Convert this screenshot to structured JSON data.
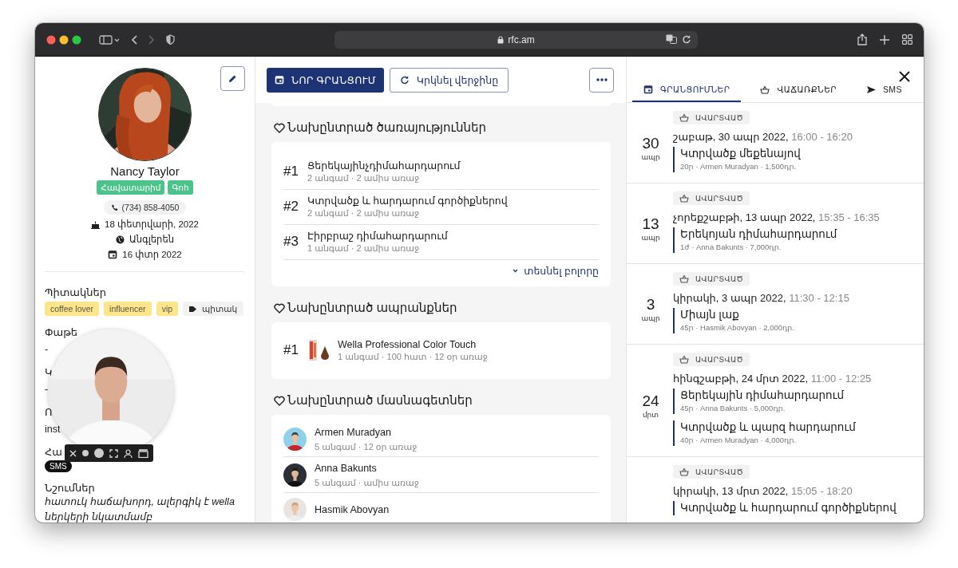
{
  "browser": {
    "url": "rfc.am"
  },
  "profile": {
    "name": "Nancy Taylor",
    "badges": [
      "Հավատարիմ",
      "Գոհ"
    ],
    "phone": "(734) 858-4050",
    "birthday": "18 փետրվարի, 2022",
    "language": "Անգլերեն",
    "since": "16 փտր 2022"
  },
  "tags": {
    "title": "Պիտակներ",
    "items": [
      {
        "label": "coffee lover",
        "kind": "tag"
      },
      {
        "label": "influencer",
        "kind": "tag"
      },
      {
        "label": "vip",
        "kind": "tag"
      },
      {
        "label": "պիտակ",
        "kind": "add"
      }
    ]
  },
  "fields": [
    {
      "label": "Փաթե",
      "value": "-"
    },
    {
      "label": "Կ",
      "value": "-"
    },
    {
      "label": "Ո",
      "value": "inst"
    },
    {
      "label": "Հա",
      "chip": "SMS"
    }
  ],
  "notes": {
    "title": "Նշումներ",
    "text": "հատուկ հաճախորդ, ալերգիկ է wella ներկերի նկատմամբ"
  },
  "toolbar": {
    "new_booking": "ՆՈՐ ԳՐԱՆՑՈՒՄ",
    "repeat": "Կրկնել վերջինը"
  },
  "services": {
    "title": "Նախընտրած ծառայություններ",
    "items": [
      {
        "rank": "#1",
        "name": "Ցերեկայինչդիմահարդարում",
        "meta": "2 անգամ · 2 ամիս առաջ"
      },
      {
        "rank": "#2",
        "name": "Կտրվածք և հարդարում գործիքներով",
        "meta": "2 անգամ · 2 ամիս առաջ"
      },
      {
        "rank": "#3",
        "name": "Էիրբրաշ դիմահարդարում",
        "meta": "1 անգամ · 2 ամիս առաջ"
      }
    ],
    "more": "տեսնել բոլորը"
  },
  "products": {
    "title": "Նախընտրած ապրանքներ",
    "items": [
      {
        "rank": "#1",
        "name": "Wella Professional Color Touch",
        "meta": "1 անգամ · 100 հատ · 12 օր առաջ"
      }
    ]
  },
  "specialists": {
    "title": "Նախընտրած մասնագետներ",
    "items": [
      {
        "name": "Armen Muradyan",
        "meta": "5 անգամ · 12 օր առաջ"
      },
      {
        "name": "Anna Bakunts",
        "meta": "5 անգամ · ամիս առաջ"
      },
      {
        "name": "Hasmik Abovyan"
      }
    ]
  },
  "tabs": [
    {
      "label": "ԳՐԱՆՑՈՒՄՆԵՐ",
      "selected": true
    },
    {
      "label": "ՎԱՃԱՌՔՆԵՐ",
      "selected": false
    },
    {
      "label": "SMS",
      "selected": false
    }
  ],
  "appointments": [
    {
      "day": "30",
      "month": "ապր",
      "status": "ԱՎԱՐՏՎԱԾ",
      "date": "շաբաթ, 30 ապր 2022,",
      "time": "16:00 - 16:20",
      "services": [
        {
          "name": "Կտրվածք մեքենայով",
          "meta": "20ր · Armen Muradyan · 1,500դր."
        }
      ]
    },
    {
      "day": "13",
      "month": "ապր",
      "status": "ԱՎԱՐՏՎԱԾ",
      "date": "չորեքշաբթի, 13 ապր 2022,",
      "time": "15:35 - 16:35",
      "services": [
        {
          "name": "Երեկոյան դիմահարդարում",
          "meta": "1ժ · Anna Bakunts · 7,000դր."
        }
      ]
    },
    {
      "day": "3",
      "month": "ապր",
      "status": "ԱՎԱՐՏՎԱԾ",
      "date": "կիրակի, 3 ապր 2022,",
      "time": "11:30 - 12:15",
      "services": [
        {
          "name": "Միայն լաք",
          "meta": "45ր · Hasmik Abovyan · 2,000դր."
        }
      ]
    },
    {
      "day": "24",
      "month": "մրտ",
      "status": "ԱՎԱՐՏՎԱԾ",
      "date": "հինգշաբթի, 24 մրտ 2022,",
      "time": "11:00 - 12:25",
      "services": [
        {
          "name": "Ցերեկային դիմահարդարում",
          "meta": "45ր · Anna Bakunts · 5,000դր."
        },
        {
          "name": "Կտրվածք և պարզ հարդարում",
          "meta": "40ր · Armen Muradyan · 4,000դր."
        }
      ]
    },
    {
      "status": "ԱՎԱՐՏՎԱԾ",
      "date": "կիրակի, 13 մրտ 2022,",
      "time": "15:05 - 18:20",
      "services": [
        {
          "name": "Կտրվածք և հարդարում գործիքներով"
        }
      ]
    }
  ]
}
